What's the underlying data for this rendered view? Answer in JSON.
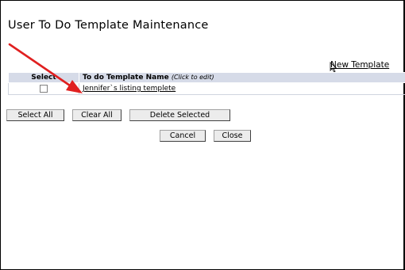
{
  "page": {
    "title": "User To Do Template Maintenance",
    "new_template_label": "New Template"
  },
  "table": {
    "columns": [
      {
        "label": "Select"
      },
      {
        "label": "To do Template Name",
        "hint": "(Click to edit)"
      }
    ],
    "rows": [
      {
        "name": "Jennifer`s listing templete",
        "selected": false
      }
    ]
  },
  "buttons": {
    "select_all": "Select All",
    "clear_all": "Clear All",
    "delete_selected": "Delete Selected",
    "cancel": "Cancel",
    "close": "Close"
  },
  "colors": {
    "header_bg": "#d6dbe8",
    "annotation_arrow": "#e02020"
  }
}
